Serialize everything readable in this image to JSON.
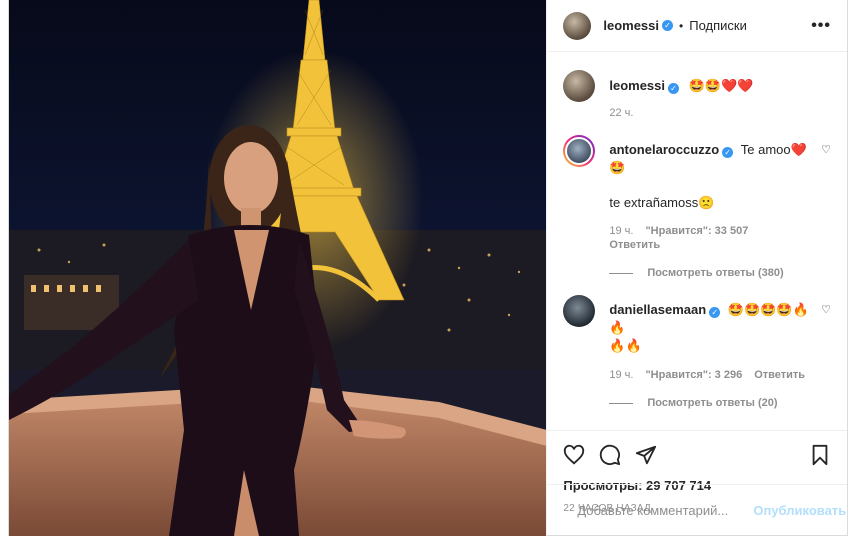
{
  "header": {
    "username": "leomessi",
    "following_label": "Подписки",
    "more_glyph": "•••"
  },
  "caption": {
    "username": "leomessi",
    "text": "🤩🤩❤️❤️",
    "time": "22 ч."
  },
  "comments": [
    {
      "username": "antonelaroccuzzo",
      "text": "Te amoo❤️",
      "text_line2": "🤩",
      "text_line3": "te extrañamoss🙁",
      "time": "19 ч.",
      "likes": "\"Нравится\": 33 507",
      "reply_label": "Ответить",
      "view_replies": "Посмотреть ответы (380)"
    },
    {
      "username": "daniellasemaan",
      "text": "🤩🤩🤩🤩🔥🔥",
      "text_line2": "🔥🔥",
      "time": "19 ч.",
      "likes": "\"Нравится\": 3 296",
      "reply_label": "Ответить",
      "view_replies": "Посмотреть ответы (20)"
    }
  ],
  "stats": {
    "views": "Просмотры: 29 707 714",
    "posted_ago": "22 ЧАСОВ НАЗАД"
  },
  "add_comment": {
    "placeholder": "Добавьте комментарий...",
    "publish_label": "Опубликовать"
  },
  "icons": [
    "heart-icon",
    "comment-icon",
    "share-icon",
    "bookmark-icon",
    "smile-icon",
    "verified-icon"
  ],
  "colors": {
    "accent": "#3897f0",
    "publish_disabled": "#b2dffc",
    "tower_light": "#f5c542"
  }
}
